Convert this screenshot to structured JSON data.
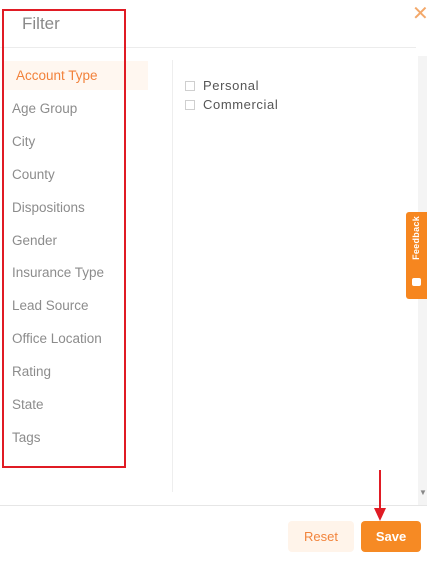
{
  "dialog": {
    "title": "Filter",
    "close_icon": "close-icon"
  },
  "sidebar": {
    "items": [
      {
        "label": "Account Type",
        "active": true
      },
      {
        "label": "Age Group"
      },
      {
        "label": "City"
      },
      {
        "label": "County"
      },
      {
        "label": "Dispositions"
      },
      {
        "label": "Gender"
      },
      {
        "label": "Insurance Type"
      },
      {
        "label": "Lead Source"
      },
      {
        "label": "Office Location"
      },
      {
        "label": "Rating"
      },
      {
        "label": "State"
      },
      {
        "label": "Tags"
      }
    ]
  },
  "options": [
    {
      "label": "Personal",
      "checked": false
    },
    {
      "label": "Commercial",
      "checked": false
    }
  ],
  "feedback": {
    "label": "Feedback"
  },
  "footer": {
    "reset_label": "Reset",
    "save_label": "Save"
  },
  "colors": {
    "accent": "#f68a24",
    "annotation_red": "#e01b24"
  }
}
